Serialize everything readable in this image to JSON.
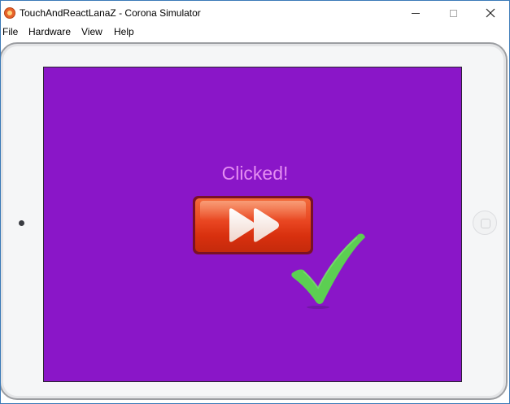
{
  "window": {
    "title": "TouchAndReactLanaZ - Corona Simulator",
    "icon": "corona-app-icon"
  },
  "controls": {
    "minimize": "minimize-icon",
    "maximize": "maximize-icon",
    "close": "close-icon"
  },
  "menu": {
    "file": "File",
    "hardware": "Hardware",
    "view": "View",
    "help": "Help"
  },
  "app": {
    "status_text": "Clicked!",
    "background_color": "#8a16c8",
    "text_color": "#e58ef2",
    "button_color": "#e84420",
    "button_icon": "fast-forward-icon",
    "confirmation_icon": "checkmark-icon",
    "check_color": "#5ccf52"
  },
  "device": {
    "frame_color": "#f5f6f7",
    "home_button_icon": "home-button-icon",
    "camera_icon": "camera-icon"
  }
}
